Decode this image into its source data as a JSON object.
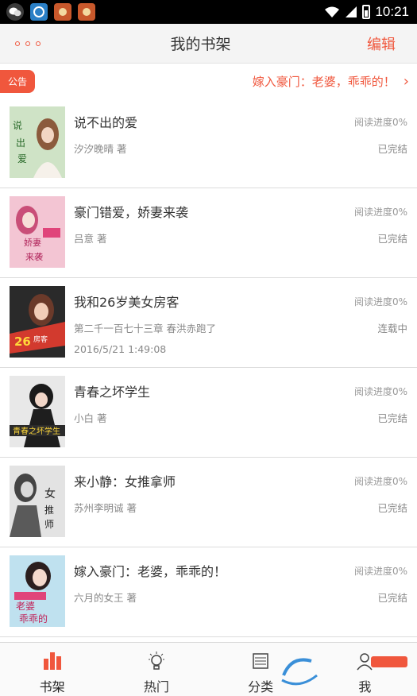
{
  "status_bar": {
    "time": "10:21",
    "icons": [
      "wechat-icon",
      "app-icon",
      "app-icon",
      "app-icon",
      "wifi-icon",
      "signal-icon",
      "battery-icon"
    ]
  },
  "nav": {
    "title": "我的书架",
    "edit_label": "编辑",
    "menu_icon": "more-dots-icon"
  },
  "notice": {
    "badge": "公告",
    "text": "嫁入豪门：老婆，乖乖的！",
    "arrow": "›"
  },
  "books": [
    {
      "title": "说不出的爱",
      "author": "汐汐晚晴 著",
      "progress": "阅读进度0%",
      "status": "已完结",
      "date": "",
      "cover_color": "#cfe3c6"
    },
    {
      "title": "豪门错爱，娇妻来袭",
      "author": "吕意 著",
      "progress": "阅读进度0%",
      "status": "已完结",
      "date": "",
      "cover_color": "#f3c5d3"
    },
    {
      "title": "我和26岁美女房客",
      "author": "第二千一百七十三章 春洪赤跑了",
      "progress": "阅读进度0%",
      "status": "连载中",
      "date": "2016/5/21 1:49:08",
      "cover_color": "#d23a2e"
    },
    {
      "title": "青春之坏学生",
      "author": "小白 著",
      "progress": "阅读进度0%",
      "status": "已完结",
      "date": "",
      "cover_color": "#2b2b2b"
    },
    {
      "title": "来小静：女推拿师",
      "author": "苏州李明诚 著",
      "progress": "阅读进度0%",
      "status": "已完结",
      "date": "",
      "cover_color": "#e0e0e0"
    },
    {
      "title": "嫁入豪门：老婆，乖乖的！",
      "author": "六月的女王 著",
      "progress": "阅读进度0%",
      "status": "已完结",
      "date": "",
      "cover_color": "#bfe1ef"
    }
  ],
  "tabs": [
    {
      "label": "书架",
      "icon": "bookshelf-icon",
      "active": true
    },
    {
      "label": "热门",
      "icon": "lightbulb-icon",
      "active": false
    },
    {
      "label": "分类",
      "icon": "category-icon",
      "active": false
    },
    {
      "label": "我",
      "icon": "user-icon",
      "active": false
    }
  ],
  "accent_color": "#f0573d"
}
